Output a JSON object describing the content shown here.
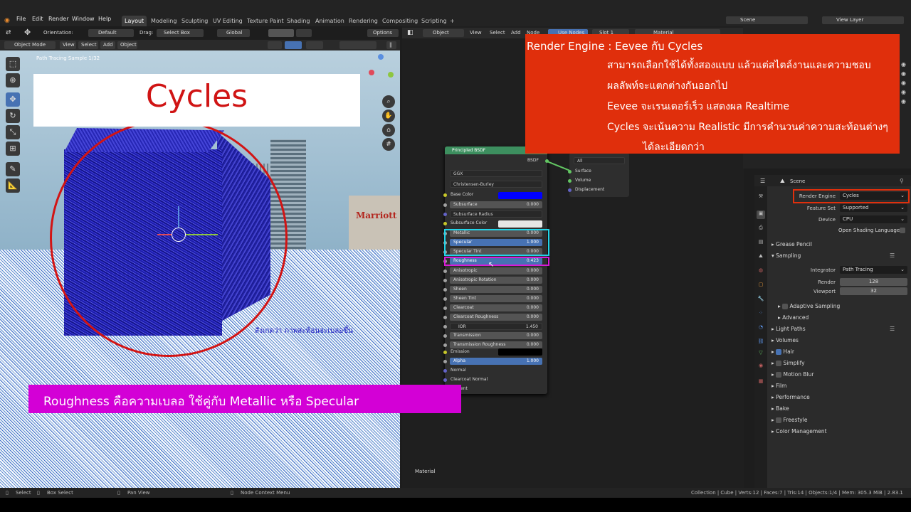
{
  "topbar": {
    "menus": [
      "File",
      "Edit",
      "Render",
      "Window",
      "Help"
    ],
    "workspaces": [
      "Layout",
      "Modeling",
      "Sculpting",
      "UV Editing",
      "Texture Paint",
      "Shading",
      "Animation",
      "Rendering",
      "Compositing",
      "Scripting"
    ],
    "add_tab": "+",
    "scene": "Scene",
    "view_layer": "View Layer"
  },
  "tool_header": {
    "orientation_label": "Orientation:",
    "orientation_value": "Default",
    "drag_label": "Drag:",
    "drag_value": "Select Box",
    "transform": "Global",
    "options": "Options"
  },
  "viewport": {
    "mode": "Object Mode",
    "menus": [
      "View",
      "Select",
      "Add",
      "Object"
    ],
    "sample_text": "Path Tracing Sample 1/32",
    "overlay_title": "Cycles",
    "cube_note": "สังเกตว่า ภาพสะท้อนจะเบลอขึ้น",
    "hotel_sign": "Marriott"
  },
  "roughness_banner": "Roughness คือความเบลอ ใช้คู่กับ Metallic หรือ Specular",
  "node_editor": {
    "editor_type": "Object",
    "menus": [
      "View",
      "Select",
      "Add",
      "Node"
    ],
    "use_nodes": "Use Nodes",
    "slot": "Slot 1",
    "material": "Material",
    "footer": "Material",
    "bsdf": {
      "title": "Principled BSDF",
      "output": "BSDF",
      "distribution": "GGX",
      "subsurface_method": "Christensen-Burley",
      "base_color_label": "Base Color",
      "base_color": "#0000ff",
      "subsurface_color_label": "Subsurface Color",
      "subsurface_radius_label": "Subsurface Radius",
      "params": [
        {
          "name": "Subsurface",
          "value": "0.000"
        },
        {
          "name": "Metallic",
          "value": "0.000"
        },
        {
          "name": "Specular",
          "value": "1.000"
        },
        {
          "name": "Specular Tint",
          "value": "0.000"
        },
        {
          "name": "Roughness",
          "value": "0.423"
        },
        {
          "name": "Anisotropic",
          "value": "0.000"
        },
        {
          "name": "Anisotropic Rotation",
          "value": "0.000"
        },
        {
          "name": "Sheen",
          "value": "0.000"
        },
        {
          "name": "Sheen Tint",
          "value": "0.000"
        },
        {
          "name": "Clearcoat",
          "value": "0.000"
        },
        {
          "name": "Clearcoat Roughness",
          "value": "0.000"
        },
        {
          "name": "IOR",
          "value": "1.450"
        },
        {
          "name": "Transmission",
          "value": "0.000"
        },
        {
          "name": "Transmission Roughness",
          "value": "0.000"
        }
      ],
      "emission_label": "Emission",
      "alpha_label": "Alpha",
      "alpha_value": "1.000",
      "normal_label": "Normal",
      "clearcoat_normal_label": "Clearcoat Normal",
      "tangent_label": "Tangent"
    },
    "output_node": {
      "target": "All",
      "sockets": [
        "Surface",
        "Volume",
        "Displacement"
      ]
    }
  },
  "info_box": {
    "line1": "Render Engine : Eevee กับ Cycles",
    "line2": "สามารถเลือกใช้ได้ทั้งสองแบบ แล้วแต่สไตล์งานและความชอบ",
    "line3": "ผลลัพท์จะแตกต่างกันออกไป",
    "line4": "Eevee จะเรนเดอร์เร็ว แสดงผล Realtime",
    "line5": "Cycles จะเน้นความ Realistic มีการคำนวนค่าความสะท้อนต่างๆ",
    "line6": "ได้ละเอียดกว่า"
  },
  "properties": {
    "scene_label": "Scene",
    "render_engine_label": "Render Engine",
    "render_engine": "Cycles",
    "feature_set_label": "Feature Set",
    "feature_set": "Supported",
    "device_label": "Device",
    "device": "CPU",
    "osl_label": "Open Shading Language",
    "grease_pencil": "Grease Pencil",
    "sampling": "Sampling",
    "integrator_label": "Integrator",
    "integrator": "Path Tracing",
    "render_label": "Render",
    "render_samples": "128",
    "viewport_label": "Viewport",
    "viewport_samples": "32",
    "adaptive_sampling": "Adaptive Sampling",
    "advanced": "Advanced",
    "light_paths": "Light Paths",
    "volumes": "Volumes",
    "hair": "Hair",
    "simplify": "Simplify",
    "motion_blur": "Motion Blur",
    "film": "Film",
    "performance": "Performance",
    "bake": "Bake",
    "freestyle": "Freestyle",
    "color_management": "Color Management"
  },
  "statusbar": {
    "select": "Select",
    "box_select": "Box Select",
    "pan_view": "Pan View",
    "context_menu": "Node Context Menu",
    "stats": "Collection | Cube | Verts:12 | Faces:7 | Tris:14 | Objects:1/4 | Mem: 305.3 MiB | 2.83.1"
  }
}
